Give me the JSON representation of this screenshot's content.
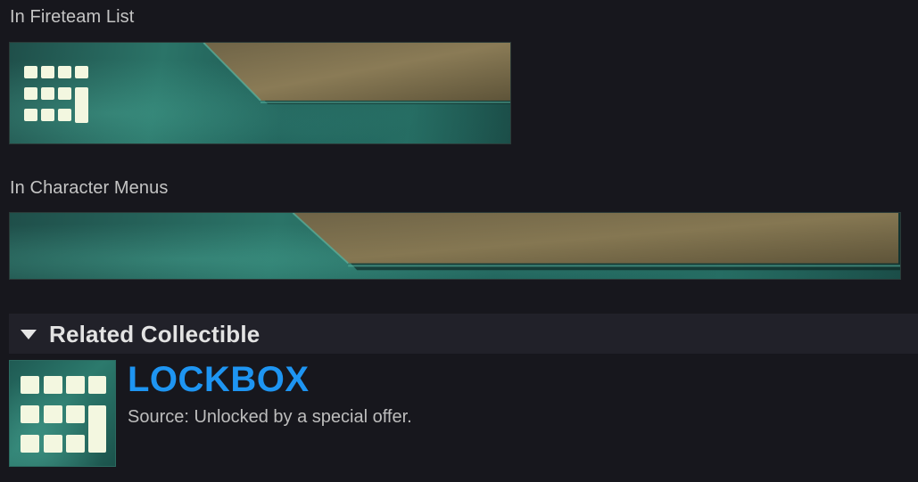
{
  "captions": {
    "fireteam": "In Fireteam List",
    "character": "In Character Menus"
  },
  "section": {
    "title": "Related Collectible"
  },
  "collectible": {
    "name": "LOCKBOX",
    "source": "Source: Unlocked by a special offer.",
    "icon": "lockbox-grid-icon"
  },
  "colors": {
    "background": "#17171d",
    "section_header": "#212129",
    "name_blue": "#1e95f2",
    "teal": "#2b7468",
    "gold": "#7d6e4c"
  }
}
